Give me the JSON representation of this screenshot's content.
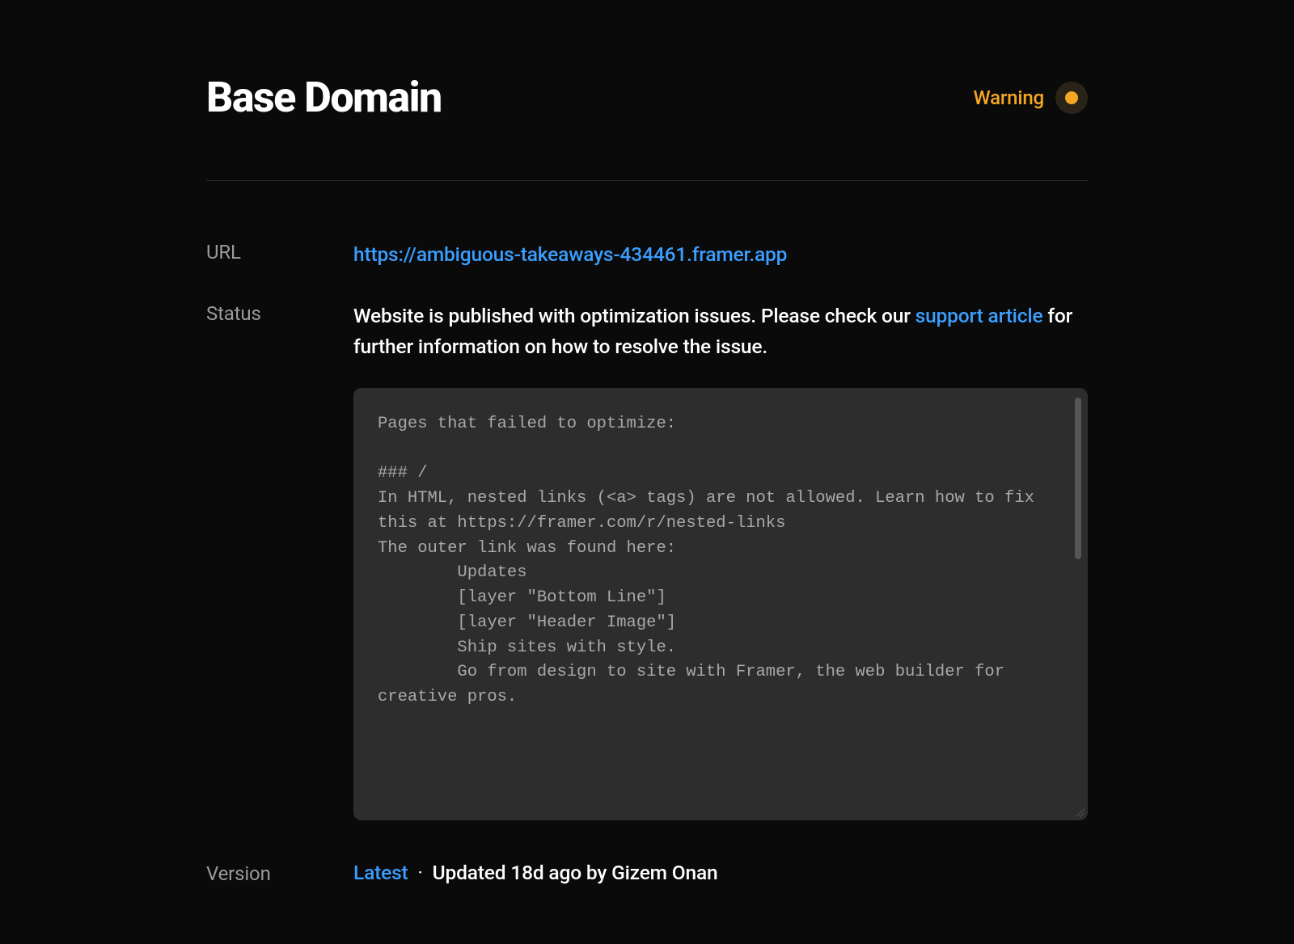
{
  "header": {
    "title": "Base Domain",
    "badge": {
      "label": "Warning",
      "color": "#f5a623"
    }
  },
  "fields": {
    "url": {
      "label": "URL",
      "value": "https://ambiguous-takeaways-434461.framer.app"
    },
    "status": {
      "label": "Status",
      "text_before_link": "Website is published with optimization issues. Please check our ",
      "link_text": "support article",
      "text_after_link": " for further information on how to resolve the issue."
    },
    "version": {
      "label": "Version",
      "link_text": "Latest",
      "separator": "·",
      "meta": "Updated 18d ago by Gizem Onan"
    }
  },
  "code_block": "Pages that failed to optimize:\n\n### /\nIn HTML, nested links (<a> tags) are not allowed. Learn how to fix this at https://framer.com/r/nested-links\nThe outer link was found here:\n        Updates\n        [layer \"Bottom Line\"]\n        [layer \"Header Image\"]\n        Ship sites with style.\n        Go from design to site with Framer, the web builder for creative pros."
}
